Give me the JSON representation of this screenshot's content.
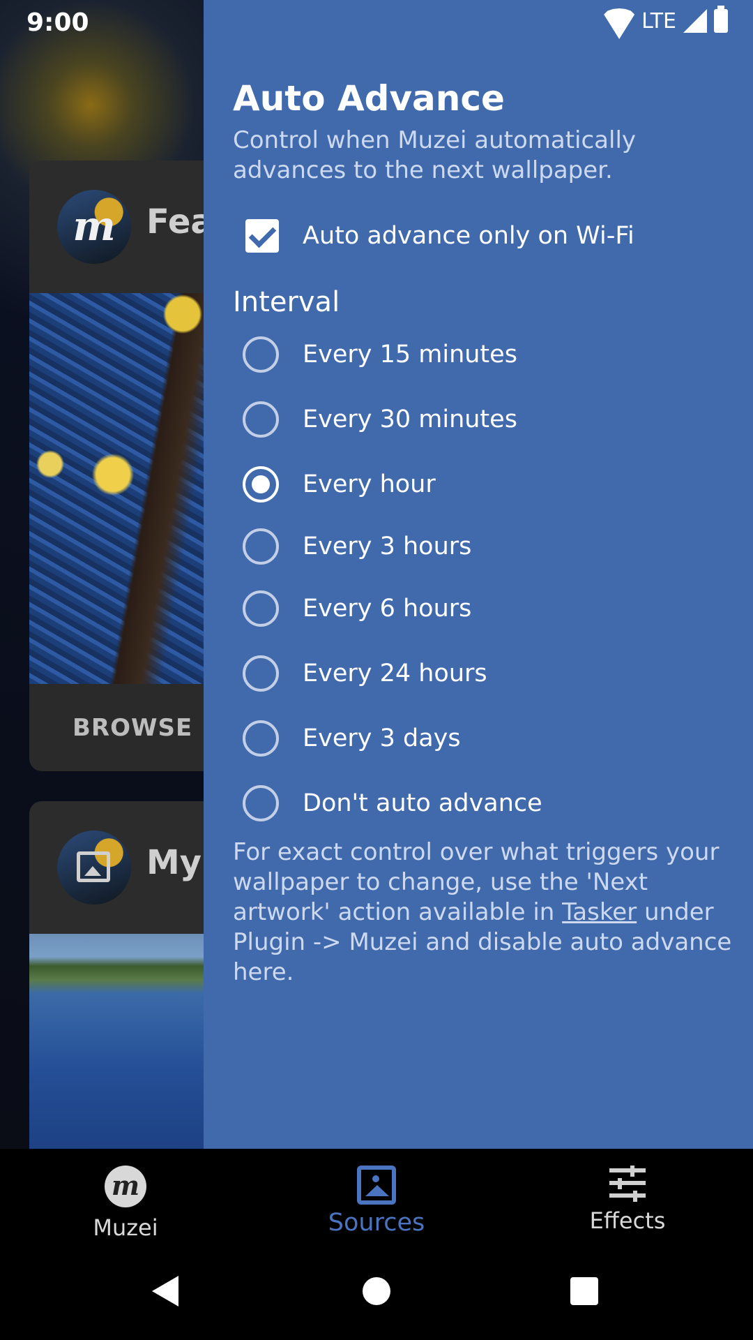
{
  "status_bar": {
    "time": "9:00",
    "network": "LTE"
  },
  "background_cards": [
    {
      "title_partial": "Fea",
      "action": "BROWSE"
    },
    {
      "title_partial": "My"
    }
  ],
  "drawer": {
    "title": "Auto Advance",
    "description": "Control when Muzei automatically advances to the next wallpaper.",
    "wifi_checkbox": {
      "label": "Auto advance only on Wi-Fi",
      "checked": true
    },
    "interval_label": "Interval",
    "intervals": [
      {
        "label": "Every 15 minutes",
        "selected": false
      },
      {
        "label": "Every 30 minutes",
        "selected": false
      },
      {
        "label": "Every hour",
        "selected": true
      },
      {
        "label": "Every 3 hours",
        "selected": false
      },
      {
        "label": "Every 6 hours",
        "selected": false
      },
      {
        "label": "Every 24 hours",
        "selected": false
      },
      {
        "label": "Every 3 days",
        "selected": false
      },
      {
        "label": "Don't auto advance",
        "selected": false
      }
    ],
    "footer": {
      "before_link": "For exact control over what triggers your wallpaper to change, use the 'Next artwork' action available in ",
      "link": "Tasker",
      "after_link": " under Plugin -> Muzei and disable auto advance here."
    }
  },
  "bottom_nav": {
    "items": [
      {
        "label": "Muzei",
        "icon": "muzei-logo-icon",
        "active": false
      },
      {
        "label": "Sources",
        "icon": "image-frame-icon",
        "active": true
      },
      {
        "label": "Effects",
        "icon": "tune-sliders-icon",
        "active": false
      }
    ],
    "active_color": "#4a73c0"
  },
  "colors": {
    "drawer_bg": "#416aad",
    "accent": "#4a73c0"
  }
}
